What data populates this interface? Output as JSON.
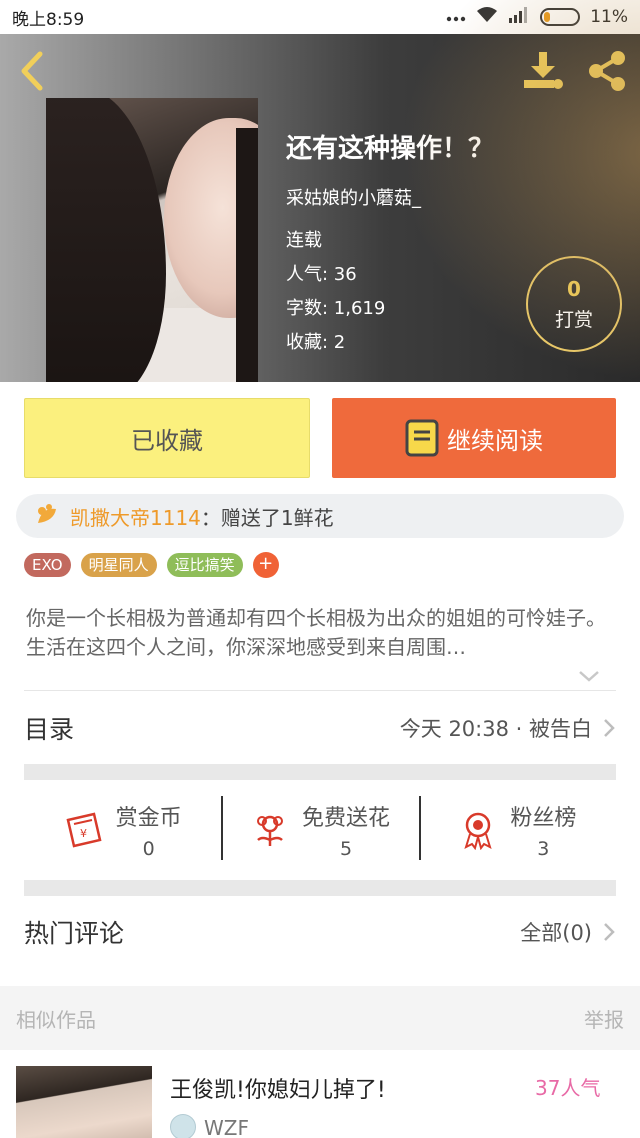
{
  "status": {
    "time": "晚上8:59",
    "battery": "11%"
  },
  "book": {
    "title": "还有这种操作！？",
    "author": "采姑娘的小蘑菇_",
    "status": "连载",
    "popularity": "人气: 36",
    "word_count": "字数: 1,619",
    "favorites": "收藏: 2"
  },
  "tip": {
    "count": "0",
    "label": "打赏"
  },
  "actions": {
    "collected": "已收藏",
    "continue": "继续阅读"
  },
  "gift": {
    "user": "凯撒大帝1114",
    "text": "：赠送了1鲜花"
  },
  "tags": [
    "EXO",
    "明星同人",
    "逗比搞笑"
  ],
  "tag_add": "+",
  "description": "你是一个长相极为普通却有四个长相极为出众的姐姐的可怜娃子。生活在这四个人之间，你深深地感受到来自周围…",
  "toc": {
    "label": "目录",
    "latest": "今天 20:38 · 被告白"
  },
  "stats": [
    {
      "name": "赏金币",
      "value": "0"
    },
    {
      "name": "免费送花",
      "value": "5"
    },
    {
      "name": "粉丝榜",
      "value": "3"
    }
  ],
  "comments": {
    "label": "热门评论",
    "all": "全部(0)"
  },
  "similar": {
    "label": "相似作品",
    "report": "举报",
    "item": {
      "title": "王俊凯!你媳妇儿掉了!",
      "popularity": "37人气",
      "author": "WZF"
    }
  },
  "colors": {
    "accent": "#ef6a3c",
    "collected_bg": "#fbf07e",
    "gift_user": "#ee9a2a",
    "popularity": "#e86aa6",
    "gold": "#f1cf5a"
  }
}
